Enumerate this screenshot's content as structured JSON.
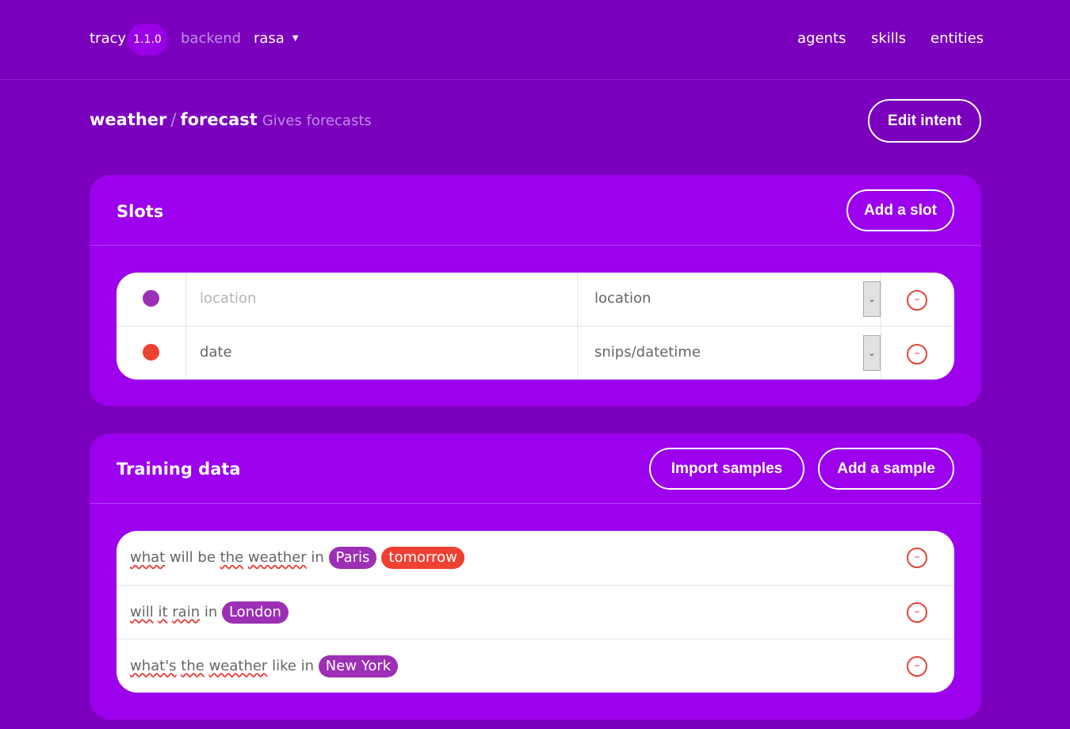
{
  "header": {
    "brand": "tracy",
    "version": "1.1.0",
    "backend_label": "backend",
    "backend_value": "rasa",
    "nav": [
      "agents",
      "skills",
      "entities"
    ]
  },
  "breadcrumb": {
    "skill": "weather",
    "separator": "/",
    "intent": "forecast",
    "description": "Gives forecasts"
  },
  "buttons": {
    "edit_intent": "Edit intent",
    "add_slot": "Add a slot",
    "import_samples": "Import samples",
    "add_sample": "Add a sample"
  },
  "slots": {
    "title": "Slots",
    "rows": [
      {
        "name": "",
        "name_placeholder": "location",
        "type": "location",
        "color": "#9c2fb6"
      },
      {
        "name": "date",
        "name_placeholder": "",
        "type": "snips/datetime",
        "color": "#ef4132"
      }
    ]
  },
  "training": {
    "title": "Training data",
    "samples": [
      {
        "parts": [
          {
            "kind": "word",
            "text": "what",
            "sq": true
          },
          {
            "kind": "word",
            "text": " will ",
            "sq": false
          },
          {
            "kind": "word",
            "text": "be ",
            "sq": false
          },
          {
            "kind": "word",
            "text": "the",
            "sq": true
          },
          {
            "kind": "word",
            "text": " ",
            "sq": false
          },
          {
            "kind": "word",
            "text": "weather",
            "sq": true
          },
          {
            "kind": "word",
            "text": " in ",
            "sq": false
          },
          {
            "kind": "chip",
            "text": "Paris",
            "slot": "location"
          },
          {
            "kind": "chip",
            "text": "tomorrow",
            "slot": "date"
          }
        ]
      },
      {
        "parts": [
          {
            "kind": "word",
            "text": "will",
            "sq": true
          },
          {
            "kind": "word",
            "text": " ",
            "sq": false
          },
          {
            "kind": "word",
            "text": "it",
            "sq": true
          },
          {
            "kind": "word",
            "text": " ",
            "sq": false
          },
          {
            "kind": "word",
            "text": "rain",
            "sq": true
          },
          {
            "kind": "word",
            "text": " in ",
            "sq": false
          },
          {
            "kind": "chip",
            "text": "London",
            "slot": "location"
          }
        ]
      },
      {
        "parts": [
          {
            "kind": "word",
            "text": "what's",
            "sq": true
          },
          {
            "kind": "word",
            "text": " ",
            "sq": false
          },
          {
            "kind": "word",
            "text": "the",
            "sq": true
          },
          {
            "kind": "word",
            "text": " ",
            "sq": false
          },
          {
            "kind": "word",
            "text": "weather",
            "sq": true
          },
          {
            "kind": "word",
            "text": " like in ",
            "sq": false
          },
          {
            "kind": "chip",
            "text": "New York",
            "slot": "location"
          }
        ]
      }
    ]
  },
  "icons": {
    "remove": "minus-circle-icon",
    "dropdown": "chevron-down-icon"
  },
  "colors": {
    "background": "#7b00bd",
    "panel": "#9c00ec",
    "slot_location": "#9c2fb6",
    "slot_date": "#ef4132"
  }
}
